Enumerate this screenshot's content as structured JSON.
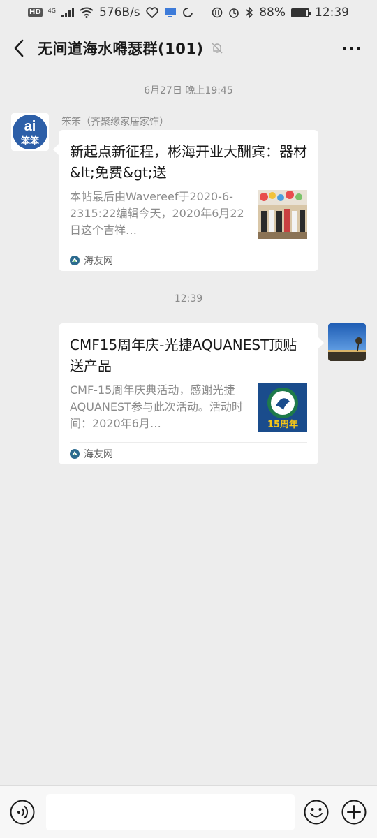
{
  "status_bar": {
    "network_badge": "HD",
    "network_type": "4G",
    "speed": "576B/s",
    "battery": "88%",
    "battery_level": 0.88,
    "time": "12:39"
  },
  "header": {
    "back_icon": "chevron-left-icon",
    "title": "无间道海水嘚瑟群(101)",
    "mute_icon": "bell-off-icon",
    "more_icon": "more-icon"
  },
  "messages": [
    {
      "timestamp": "6月27日 晚上19:45",
      "sender": "笨笨（齐聚缘家居家饰）",
      "side": "left",
      "avatar_text": "ai",
      "avatar_subtext": "笨笨",
      "title": "新起点新征程，彬海开业大酬宾：器材&lt;免费&gt;送",
      "desc": "本帖最后由Wavereef于2020-6-2315:22编辑今天，2020年6月22日这个吉祥…",
      "source": "海友网"
    },
    {
      "timestamp": "12:39",
      "side": "right",
      "title": "CMF15周年庆-光捷AQUANEST顶贴送产品",
      "desc": "CMF-15周年庆典活动，感谢光捷AQUANEST参与此次活动。活动时间：2020年6月…",
      "thumb_text": "15周年",
      "source": "海友网"
    }
  ],
  "input_bar": {
    "voice_icon": "voice-icon",
    "input_value": "",
    "emoji_icon": "emoji-icon",
    "plus_icon": "plus-icon"
  },
  "colors": {
    "background": "#ededed",
    "card": "#ffffff",
    "timestamp": "#8a8a8a",
    "source_icon": "#2c6b8f"
  }
}
